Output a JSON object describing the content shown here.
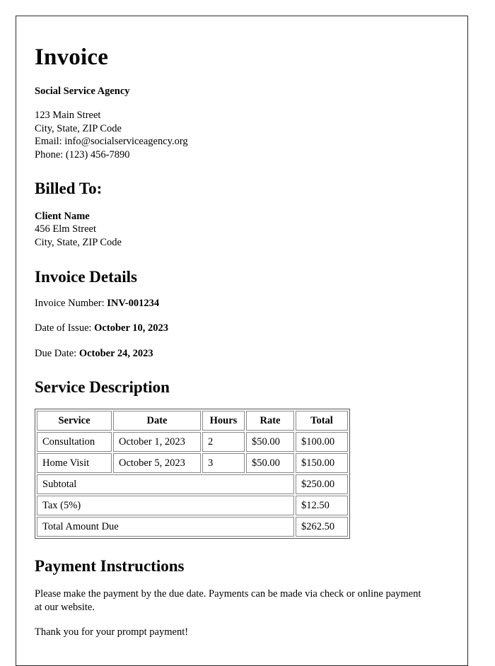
{
  "document": {
    "title": "Invoice"
  },
  "sender": {
    "org_name": "Social Service Agency",
    "address_lines": [
      "123 Main Street",
      "City, State, ZIP Code",
      "Email: info@socialserviceagency.org",
      "Phone: (123) 456-7890"
    ]
  },
  "billed_to": {
    "heading": "Billed To:",
    "client_name": "Client Name",
    "address_lines": [
      "456 Elm Street",
      "City, State, ZIP Code"
    ]
  },
  "invoice_details": {
    "heading": "Invoice Details",
    "rows": [
      {
        "label": "Invoice Number:",
        "value": "INV-001234"
      },
      {
        "label": "Date of Issue:",
        "value": "October 10, 2023"
      },
      {
        "label": "Due Date:",
        "value": "October 24, 2023"
      }
    ]
  },
  "service_description": {
    "heading": "Service Description",
    "columns": [
      "Service",
      "Date",
      "Hours",
      "Rate",
      "Total"
    ],
    "rows": [
      [
        "Consultation",
        "October 1, 2023",
        "2",
        "$50.00",
        "$100.00"
      ],
      [
        "Home Visit",
        "October 5, 2023",
        "3",
        "$50.00",
        "$150.00"
      ]
    ],
    "summary": [
      {
        "label": "Subtotal",
        "value": "$250.00"
      },
      {
        "label": "Tax (5%)",
        "value": "$12.50"
      },
      {
        "label": "Total Amount Due",
        "value": "$262.50"
      }
    ]
  },
  "payment_instructions": {
    "heading": "Payment Instructions",
    "paragraphs": [
      "Please make the payment by the due date. Payments can be made via check or online payment at our website.",
      "Thank you for your prompt payment!"
    ]
  }
}
